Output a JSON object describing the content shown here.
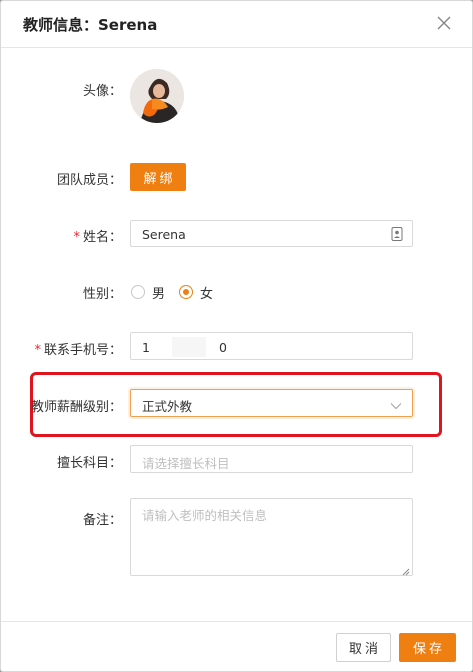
{
  "dialog": {
    "title": "教师信息：Serena",
    "close_icon": "close-icon"
  },
  "form": {
    "avatar": {
      "label": "头像："
    },
    "team_member": {
      "label": "团队成员：",
      "button_label": "解绑"
    },
    "name": {
      "required_mark": "*",
      "label": "姓名：",
      "value": "Serena",
      "icon": "contact-card-icon"
    },
    "gender": {
      "label": "性别：",
      "options": [
        "男",
        "女"
      ],
      "selected": "女"
    },
    "phone": {
      "required_mark": "*",
      "label": "联系手机号：",
      "value_start": "1",
      "value_end": "0"
    },
    "salary_level": {
      "label": "教师薪酬级别：",
      "value": "正式外教",
      "icon": "chevron-down-icon"
    },
    "subject": {
      "label": "擅长科目：",
      "placeholder": "请选择擅长科目"
    },
    "remark": {
      "label": "备注：",
      "placeholder": "请输入老师的相关信息"
    }
  },
  "footer": {
    "cancel_label": "取消",
    "save_label": "保存"
  },
  "colors": {
    "accent": "#f07f12",
    "required": "#f5222d",
    "highlight": "#e0141e"
  }
}
